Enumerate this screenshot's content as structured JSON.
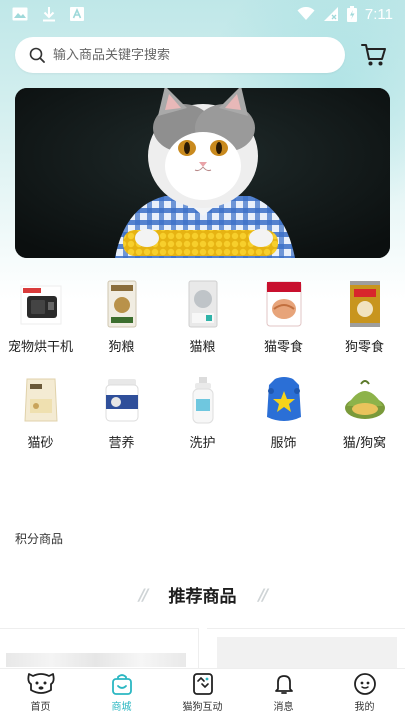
{
  "status_bar": {
    "time": "7:11"
  },
  "search": {
    "placeholder": "输入商品关键字搜索"
  },
  "categories": [
    {
      "label": "宠物烘干机",
      "icon": "pet-dryer"
    },
    {
      "label": "狗粮",
      "icon": "dog-food-bag"
    },
    {
      "label": "猫粮",
      "icon": "cat-food-bag"
    },
    {
      "label": "猫零食",
      "icon": "cat-snack-pack"
    },
    {
      "label": "狗零食",
      "icon": "dog-snack-can"
    },
    {
      "label": "猫砂",
      "icon": "cat-litter-bag"
    },
    {
      "label": "营养",
      "icon": "nutrition-jar"
    },
    {
      "label": "洗护",
      "icon": "shampoo-bottle"
    },
    {
      "label": "服饰",
      "icon": "pet-clothing"
    },
    {
      "label": "猫/狗窝",
      "icon": "pet-bed"
    }
  ],
  "points_label": "积分商品",
  "recommend_title": "推荐商品",
  "tabs": [
    {
      "label": "首页",
      "icon": "dog-face-icon",
      "active": false
    },
    {
      "label": "商城",
      "icon": "shopping-bag-icon",
      "active": true
    },
    {
      "label": "猫狗互动",
      "icon": "interact-icon",
      "active": false
    },
    {
      "label": "消息",
      "icon": "bell-icon",
      "active": false
    },
    {
      "label": "我的",
      "icon": "profile-face-icon",
      "active": false
    }
  ],
  "colors": {
    "accent": "#2bb7c2",
    "header_bg": "#c8ecec"
  }
}
